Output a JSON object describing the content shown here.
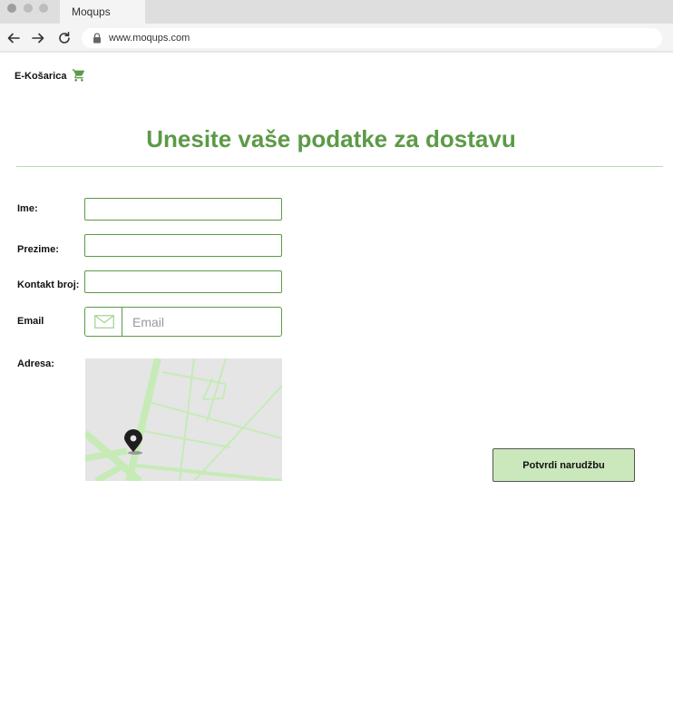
{
  "browser": {
    "tab_title": "Moqups",
    "url": "www.moqups.com"
  },
  "header": {
    "brand": "E-Košarica"
  },
  "page": {
    "title": "Unesite vaše podatke za dostavu"
  },
  "form": {
    "first_name": {
      "label": "Ime:",
      "value": ""
    },
    "last_name": {
      "label": "Prezime:",
      "value": ""
    },
    "phone": {
      "label": "Kontakt broj:",
      "value": ""
    },
    "email": {
      "label": "Email",
      "value": "",
      "placeholder": "Email"
    },
    "address": {
      "label": "Adresa:"
    }
  },
  "actions": {
    "confirm_label": "Potvrdi narudžbu"
  },
  "icons": {
    "cart": "shopping-cart-icon",
    "mail": "envelope-icon",
    "map_pin": "map-pin-icon",
    "lock": "lock-icon"
  },
  "colors": {
    "accent": "#5c9a47",
    "accent_light": "#cbe8bd",
    "divider": "#b9dca9"
  }
}
